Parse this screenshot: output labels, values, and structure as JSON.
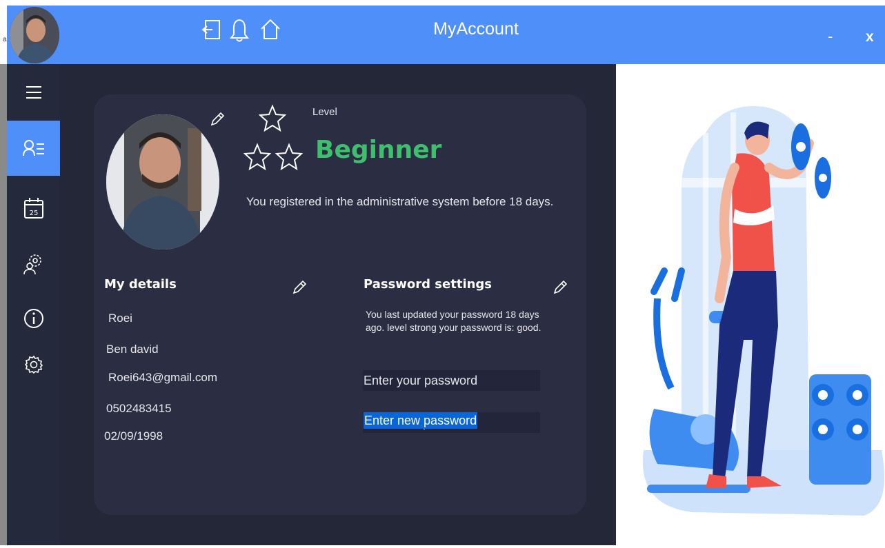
{
  "window": {
    "title": "MyAccount",
    "minimize_label": "-",
    "close_label": "x",
    "corner_text": "a"
  },
  "topbar_icons": [
    "logout-icon",
    "bell-icon",
    "home-icon"
  ],
  "sidebar": {
    "items": [
      {
        "icon": "menu-icon",
        "active": false
      },
      {
        "icon": "profile-list-icon",
        "active": true
      },
      {
        "icon": "calendar-icon",
        "active": false,
        "text": "25"
      },
      {
        "icon": "trainers-settings-icon",
        "active": false
      },
      {
        "icon": "info-icon",
        "active": false
      },
      {
        "icon": "gear-icon",
        "active": false
      }
    ]
  },
  "profile": {
    "level_label": "Level",
    "level_value": "Beginner",
    "registered_text": "You registered in the administrative system before 18 days."
  },
  "details": {
    "title": "My details",
    "first_name": "Roei",
    "last_name": "Ben david",
    "email": "Roei643@gmail.com",
    "phone": "0502483415",
    "birth_date": "02/09/1998"
  },
  "password": {
    "title": "Password settings",
    "info_line1": "You last updated your password 18 days",
    "info_line2": "ago. level strong your password is: good.",
    "current_placeholder": "Enter your password",
    "new_placeholder": "Enter new password"
  },
  "colors": {
    "accent": "#4f8ff9",
    "sidebar": "#242a3b",
    "main_bg": "#242737",
    "card_bg": "#2b2e43",
    "level_green": "#3fbf6e",
    "selection": "#0a66d8"
  }
}
